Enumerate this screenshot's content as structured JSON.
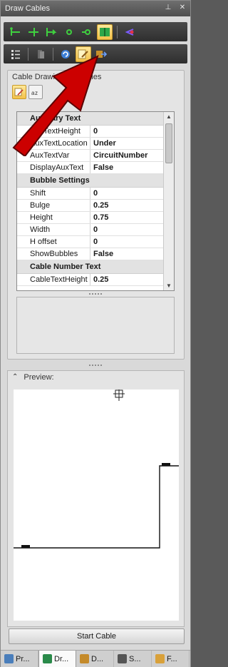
{
  "window": {
    "title": "Draw Cables",
    "pin_glyph": "⊥",
    "close_glyph": "✕"
  },
  "toolbar1": {
    "icons": [
      "cable-start-icon",
      "cable-split-icon",
      "cable-join-icon",
      "cable-dot-icon",
      "cable-end-icon",
      "cable-book-icon",
      "cable-swap-icon"
    ]
  },
  "toolbar2": {
    "icons": [
      "list-icon",
      "stack-icon",
      "refresh-icon",
      "edit-properties-icon",
      "transfer-icon"
    ]
  },
  "properties": {
    "title": "Cable Drawing Properties",
    "categories": [
      {
        "name": "Auxiliary Text",
        "rows": [
          {
            "name": "AuxTextHeight",
            "value": "0"
          },
          {
            "name": "AuxTextLocation",
            "value": "Under"
          },
          {
            "name": "AuxTextVar",
            "value": "CircuitNumber"
          },
          {
            "name": "DisplayAuxText",
            "value": "False"
          }
        ]
      },
      {
        "name": "Bubble Settings",
        "rows": [
          {
            "name": "Shift",
            "value": "0"
          },
          {
            "name": "Bulge",
            "value": "0.25"
          },
          {
            "name": "Height",
            "value": "0.75"
          },
          {
            "name": "Width",
            "value": "0"
          },
          {
            "name": "H offset",
            "value": "0"
          },
          {
            "name": "ShowBubbles",
            "value": "False"
          }
        ]
      },
      {
        "name": "Cable Number Text",
        "rows": [
          {
            "name": "CableTextHeight",
            "value": "0.25"
          }
        ]
      }
    ]
  },
  "preview": {
    "title": "Preview:"
  },
  "start_button": "Start Cable",
  "tabs": [
    {
      "label": "Pr...",
      "color": "#4a7ebb"
    },
    {
      "label": "Dr...",
      "color": "#2a8a4a"
    },
    {
      "label": "D...",
      "color": "#c48a2a"
    },
    {
      "label": "S...",
      "color": "#555555"
    },
    {
      "label": "F...",
      "color": "#d9a13a"
    }
  ],
  "colors": {
    "accent_arrow": "#cc0000",
    "toolbar_bg": "#3a3a3a",
    "active_tool": "#f4c24a"
  }
}
